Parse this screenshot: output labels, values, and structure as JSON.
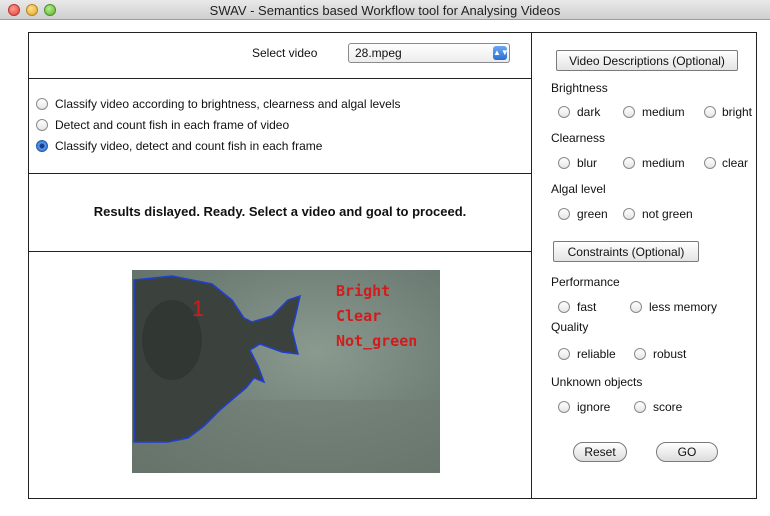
{
  "window": {
    "title": "SWAV - Semantics based Workflow tool for Analysing Videos"
  },
  "video_select": {
    "label": "Select video",
    "value": "28.mpeg"
  },
  "goals": [
    {
      "label": "Classify video according to brightness, clearness and algal levels",
      "selected": false
    },
    {
      "label": "Detect and count fish in each frame of video",
      "selected": false
    },
    {
      "label": "Classify video, detect and count fish in each frame",
      "selected": true
    }
  ],
  "status_text": "Results dislayed. Ready. Select a video and goal to proceed.",
  "video_overlay": {
    "fish_id": "1",
    "lines": [
      "Bright",
      "Clear",
      "Not_green"
    ]
  },
  "descriptions": {
    "button_label": "Video Descriptions (Optional)",
    "brightness": {
      "label": "Brightness",
      "options": [
        "dark",
        "medium",
        "bright"
      ]
    },
    "clearness": {
      "label": "Clearness",
      "options": [
        "blur",
        "medium",
        "clear"
      ]
    },
    "algal": {
      "label": "Algal level",
      "options": [
        "green",
        "not green"
      ]
    }
  },
  "constraints": {
    "button_label": "Constraints (Optional)",
    "performance": {
      "label": "Performance",
      "options": [
        "fast",
        "less memory"
      ]
    },
    "quality": {
      "label": "Quality",
      "options": [
        "reliable",
        "robust"
      ]
    },
    "unknown": {
      "label": "Unknown objects",
      "options": [
        "ignore",
        "score"
      ]
    }
  },
  "actions": {
    "reset_label": "Reset",
    "go_label": "GO"
  },
  "colors": {
    "overlay_text": "#d21c1c",
    "fish_outline": "#1f3fd0"
  }
}
